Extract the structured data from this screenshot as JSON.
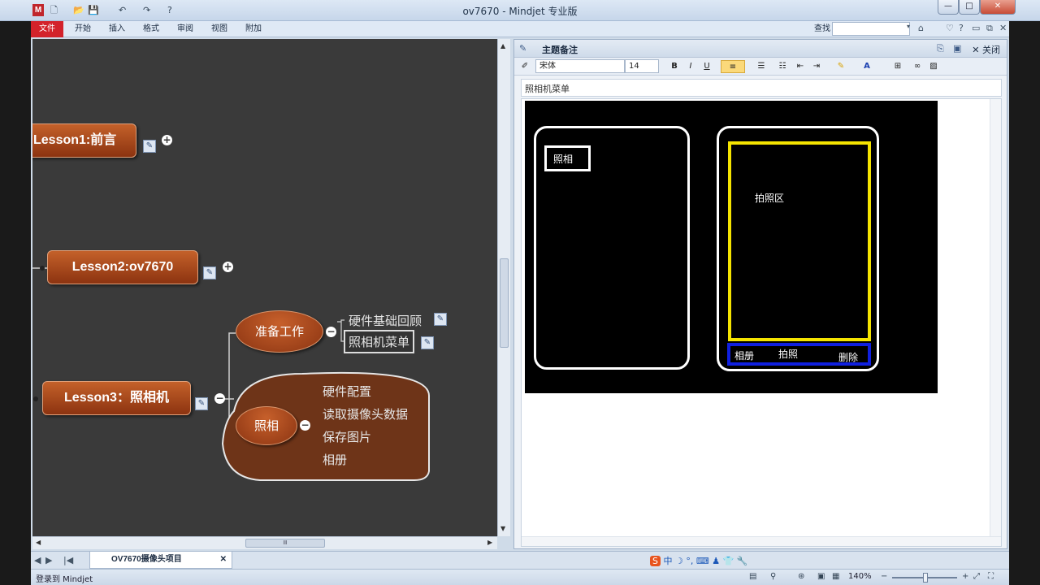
{
  "window": {
    "title": "ov7670 - Mindjet 专业版",
    "controls": {
      "minimize": "—",
      "maximize": "□",
      "close": "✕"
    }
  },
  "ribbon": {
    "tabs": [
      "文件",
      "开始",
      "插入",
      "格式",
      "审阅",
      "视图",
      "附加"
    ],
    "find_label": "查找"
  },
  "map": {
    "topics": {
      "lesson1": "Lesson1:前言",
      "lesson2": "Lesson2:ov7670",
      "lesson3": "Lesson3：照相机"
    },
    "lesson3_children": {
      "prep": "准备工作",
      "prep_items": [
        "硬件基础回顾",
        "照相机菜单"
      ],
      "camera": "照相",
      "camera_items": [
        "硬件配置",
        "读取摄像头数据",
        "保存图片",
        "相册"
      ]
    },
    "hscroll_thumb": "Ⅲ"
  },
  "notes": {
    "header_title": "主题备注",
    "close_label": "关闭",
    "font_name": "宋体",
    "font_size": "14",
    "bold": "B",
    "italic": "I",
    "underline": "U",
    "note_title": "照相机菜单",
    "image": {
      "left_button": "照相",
      "capture_area": "拍照区",
      "bottom_buttons": [
        "相册",
        "拍照",
        "删除"
      ]
    }
  },
  "doc_tab": {
    "label": "OV7670摄像头项目",
    "close": "✕"
  },
  "statusbar": {
    "login": "登录到 Mindjet",
    "zoom": "140%"
  },
  "colors": {
    "topic_fill": "#a9461b",
    "map_bg": "#3a3a3a",
    "capture_border": "#f5e400",
    "bottom_bar_border": "#1020e0"
  }
}
